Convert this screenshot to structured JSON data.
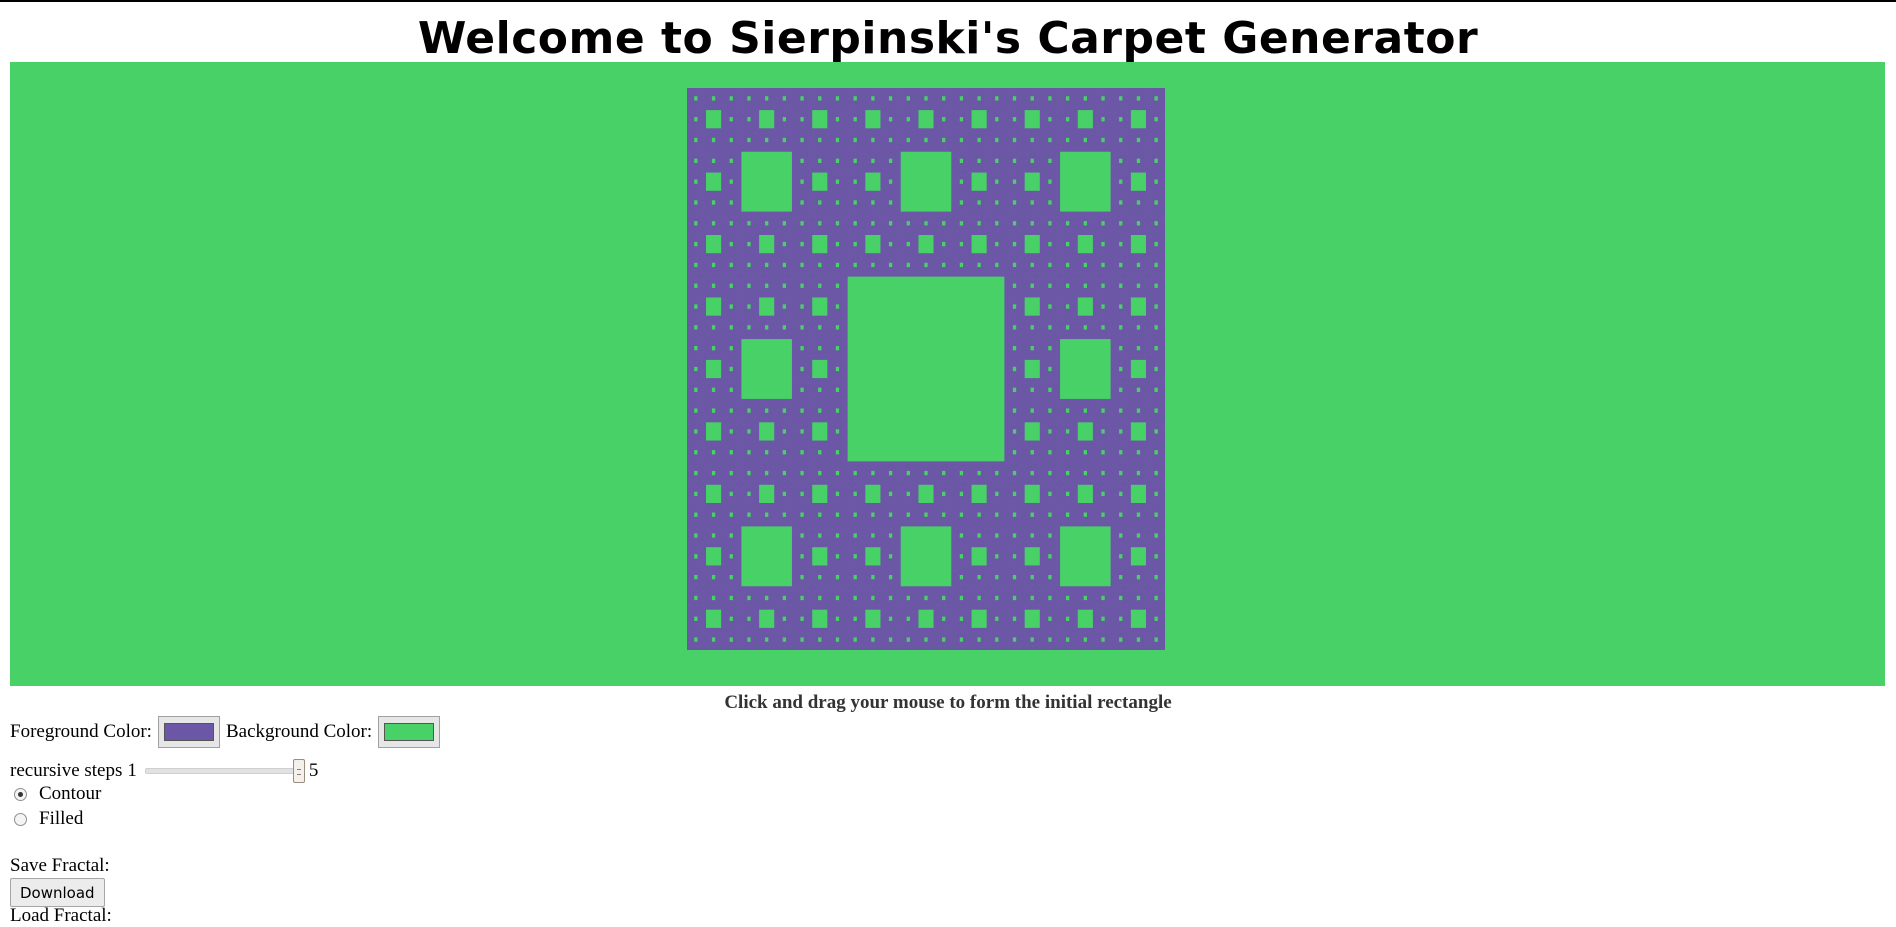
{
  "page": {
    "title": "Welcome to Sierpinski's Carpet Generator"
  },
  "canvas": {
    "background_color": "#48d167",
    "foreground_color": "#6b57a6"
  },
  "hint": "Click and drag your mouse to form the initial rectangle",
  "colors": {
    "foreground_label": "Foreground Color:",
    "foreground_value": "#6b57a6",
    "background_label": "Background Color:",
    "background_value": "#48d167"
  },
  "steps": {
    "label": "recursive steps",
    "min": 1,
    "max": 5,
    "value": 5,
    "min_label": "1",
    "max_label": "5"
  },
  "mode": {
    "options": [
      {
        "label": "Contour",
        "selected": true
      },
      {
        "label": "Filled",
        "selected": false
      }
    ]
  },
  "save": {
    "label": "Save Fractal:",
    "button": "Download"
  },
  "load": {
    "label": "Load Fractal:"
  }
}
